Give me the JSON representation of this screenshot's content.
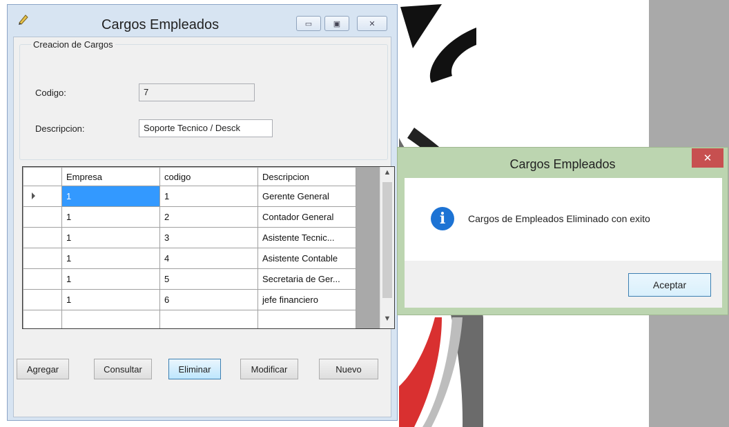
{
  "main_window": {
    "title": "Cargos Empleados",
    "group_title": "Creacion de Cargos",
    "codigo_label": "Codigo:",
    "codigo_value": "7",
    "descripcion_label": "Descripcion:",
    "descripcion_value": "Soporte Tecnico / Desck",
    "grid": {
      "columns": [
        "Empresa",
        "codigo",
        "Descripcion"
      ],
      "rows": [
        [
          "1",
          "1",
          "Gerente General"
        ],
        [
          "1",
          "2",
          "Contador General"
        ],
        [
          "1",
          "3",
          "Asistente Tecnic..."
        ],
        [
          "1",
          "4",
          "Asistente Contable"
        ],
        [
          "1",
          "5",
          "Secretaria de Ger..."
        ],
        [
          "1",
          "6",
          "jefe financiero"
        ]
      ]
    },
    "buttons": {
      "agregar": "Agregar",
      "consultar": "Consultar",
      "eliminar": "Eliminar",
      "modificar": "Modificar",
      "nuevo": "Nuevo"
    }
  },
  "message_box": {
    "title": "Cargos Empleados",
    "message": "Cargos de Empleados Eliminado con exito",
    "ok_label": "Aceptar",
    "icon": "info-icon"
  },
  "colors": {
    "selection": "#3399ff",
    "title_bar": "#d7e4f2",
    "msg_title_bar": "#bcd5b0",
    "close_red": "#c75050"
  }
}
